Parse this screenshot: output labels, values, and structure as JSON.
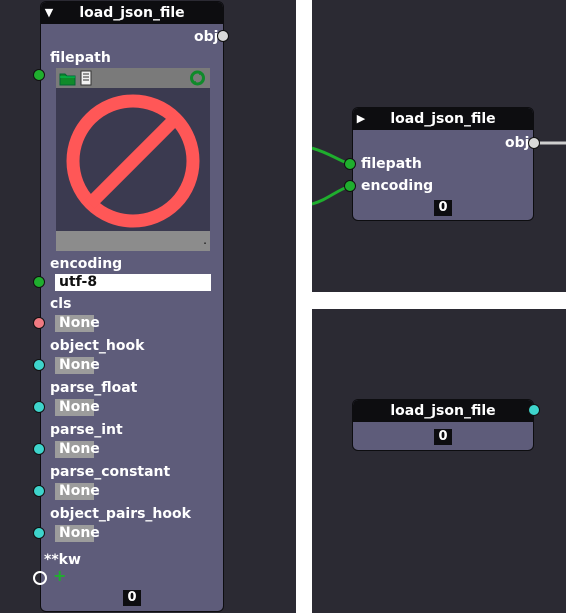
{
  "left_node": {
    "title": "load_json_file",
    "output_label": "obj",
    "filepath_label": "filepath",
    "encoding_label": "encoding",
    "encoding_value": "utf-8",
    "params": [
      {
        "label": "cls",
        "value": "None"
      },
      {
        "label": "object_hook",
        "value": "None"
      },
      {
        "label": "parse_float",
        "value": "None"
      },
      {
        "label": "parse_int",
        "value": "None"
      },
      {
        "label": "parse_constant",
        "value": "None"
      },
      {
        "label": "object_pairs_hook",
        "value": "None"
      }
    ],
    "kw_label": "**kw",
    "add_symbol": "+",
    "counter": "0",
    "preview_dot": "."
  },
  "top_right_node": {
    "title": "load_json_file",
    "output_label": "obj",
    "inputs": [
      "filepath",
      "encoding"
    ],
    "counter": "0"
  },
  "bottom_right_node": {
    "title": "load_json_file",
    "counter": "0"
  },
  "icons": {
    "folder": "folder-icon",
    "document": "document-icon",
    "reload": "reload-icon",
    "no_preview": "no-preview-icon"
  },
  "colors": {
    "background": "#2b2a33",
    "node_body": "#5e5c7a",
    "node_header": "#0d0d10",
    "socket_green": "#1fae2e",
    "socket_teal": "#3ed4cc",
    "socket_pink": "#f07a82",
    "forbidden_red": "#ff5757"
  }
}
